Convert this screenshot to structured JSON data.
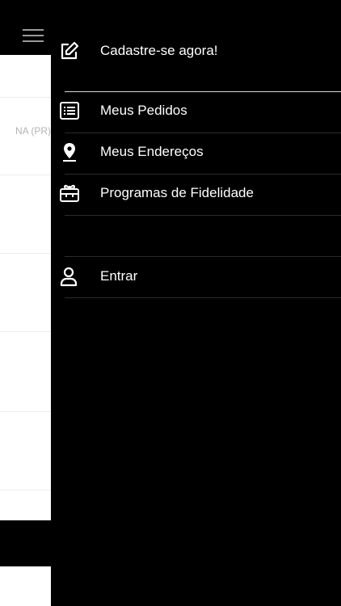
{
  "background": {
    "location_text": "NA (PR)"
  },
  "drawer": {
    "items": [
      {
        "label": "Cadastre-se agora!",
        "icon": "edit-icon"
      },
      {
        "label": "Meus Pedidos",
        "icon": "list-icon"
      },
      {
        "label": "Meus Endereços",
        "icon": "location-pin-icon"
      },
      {
        "label": "Programas de Fidelidade",
        "icon": "gift-card-icon"
      },
      {
        "label": "Entrar",
        "icon": "user-icon"
      }
    ]
  },
  "colors": {
    "drawer_bg": "#000000",
    "text": "#ffffff",
    "separator": "#2b2b2b"
  }
}
